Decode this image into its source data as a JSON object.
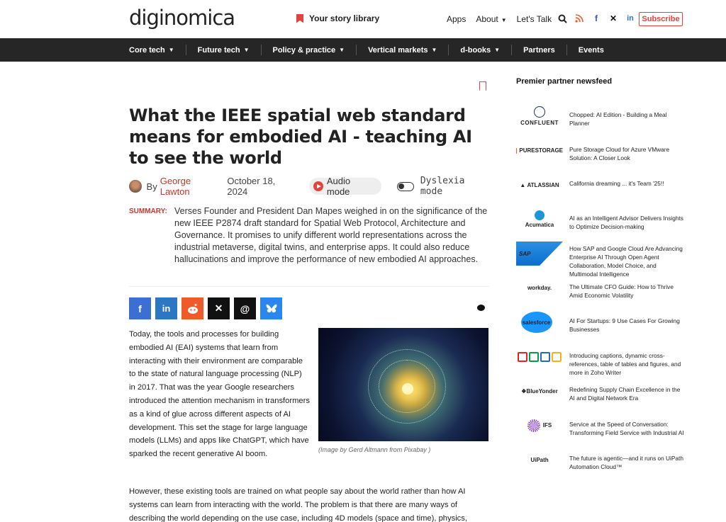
{
  "header": {
    "logo": "diginomica",
    "story_library": "Your story library",
    "nav": [
      {
        "label": "Apps",
        "caret": false
      },
      {
        "label": "About",
        "caret": true
      },
      {
        "label": "Let's Talk",
        "caret": false
      }
    ],
    "icons": [
      "search-icon",
      "rss-icon",
      "facebook-icon",
      "x-icon",
      "linkedin-icon"
    ],
    "subscribe": "Subscribe",
    "accent_color": "#e0443e"
  },
  "navbar": {
    "items": [
      {
        "label": "Core tech",
        "caret": true
      },
      {
        "label": "Future tech",
        "caret": true
      },
      {
        "label": "Policy & practice",
        "caret": true
      },
      {
        "label": "Vertical markets",
        "caret": true
      },
      {
        "label": "d-books",
        "caret": true
      },
      {
        "label": "Partners",
        "caret": false
      },
      {
        "label": "Events",
        "caret": false
      }
    ]
  },
  "article": {
    "title": "What the IEEE spatial web standard means for embodied AI - teaching AI to see the world",
    "by": "By",
    "author": "George Lawton",
    "date": "October 18, 2024",
    "audio_mode": "Audio mode",
    "dyslexia_mode": "Dyslexia mode",
    "summary_label": "SUMMARY:",
    "summary": "Verses Founder and President Dan Mapes weighed in on the significance of the new IEEE P2874 draft standard for Spatial Web Protocol, Architecture and Governance. It promises to unify different world representations across the industrial metaverse, digital twins, and enterprise apps. It could also reduce hallucinations and improve the performance of new embodied AI approaches.",
    "share_buttons": [
      {
        "name": "facebook",
        "glyph": "f",
        "color": "#3b6fd4"
      },
      {
        "name": "linkedin",
        "glyph": "in",
        "color": "#2b77c4"
      },
      {
        "name": "reddit",
        "glyph": "◕",
        "color": "#f05a28"
      },
      {
        "name": "x",
        "glyph": "𝕏",
        "color": "#111111"
      },
      {
        "name": "threads",
        "glyph": "@",
        "color": "#111111"
      },
      {
        "name": "bluesky",
        "glyph": "🦋",
        "color": "#2c86f0"
      }
    ],
    "paragraph1": "Today, the tools and processes for building embodied AI (EAI) systems that learn from interacting with their environment are comparable to the state of natural language processing (NLP) in 2017. That was the year Google researchers introduced the attention mechanism in transformers as a kind of glue across different aspects of AI development. This set the stage for large language models (LLMs) and apps like ChatGPT, which have sparked the recent generative AI boom.",
    "image_caption": "(Image by Gerd Altmann from Pixabay )",
    "paragraph2": "However, these existing tools are trained on what people say about the world rather than how AI systems can learn from interacting with the world. The problem is that there are many ways of describing the world depending on the use case, including 4D models (space and time), physics,"
  },
  "sidebar": {
    "title": "Premier partner newsfeed",
    "partners": [
      {
        "logo": "CONFLUENT",
        "headline": "Chopped: AI Edition - Building a Meal Planner"
      },
      {
        "logo": "PURESTORAGE",
        "headline": "Pure Storage Cloud for Azure VMware Solution: A Closer Look"
      },
      {
        "logo": "ATLASSIAN",
        "headline": "California dreaming ... it's Team '25!!"
      },
      {
        "logo": "Acumatica",
        "headline": "AI as an Intelligent Advisor Delivers Insights to Optimize Decision-making"
      },
      {
        "logo": "SAP",
        "headline": "How SAP and Google Cloud Are Advancing Enterprise AI Through Open Agent Collaboration, Model Choice, and Multimodal Intelligence"
      },
      {
        "logo": "workday.",
        "headline": "The Ultimate CFO Guide: How to Thrive Amid Economic Volatility"
      },
      {
        "logo": "salesforce",
        "headline": "AI For Startups: 9 Use Cases For Growing Businesses"
      },
      {
        "logo": "ZOHO",
        "headline": "Introducing captions, dynamic cross-references, table of tables and figures, and more in Zoho Writer"
      },
      {
        "logo": "BlueYonder",
        "headline": "Redefining Supply Chain Excellence in the AI and Digital Network Era"
      },
      {
        "logo": "IFS",
        "headline": "Service at the Speed of Conversation: Transforming Field Service with Industrial AI"
      },
      {
        "logo": "UiPath",
        "headline": "The future is agentic—and it runs on UiPath Automation Cloud™"
      }
    ]
  }
}
